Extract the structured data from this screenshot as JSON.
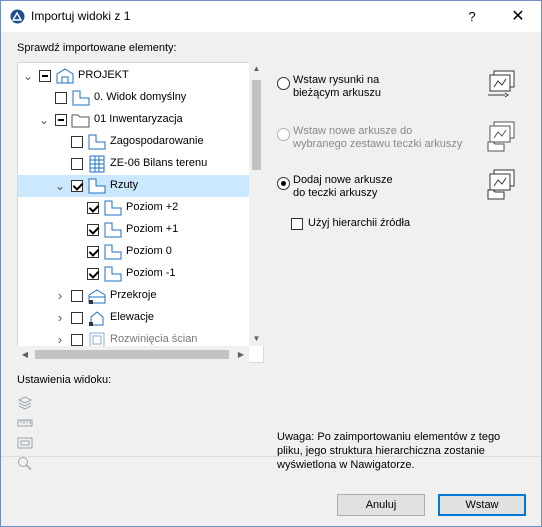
{
  "window": {
    "title": "Importuj widoki z 1"
  },
  "titlebar": {
    "help": "?",
    "close": "✕"
  },
  "labels": {
    "check_elements": "Sprawdź importowane elementy:",
    "view_settings": "Ustawienia widoku:"
  },
  "tree": {
    "items": [
      {
        "label": "PROJEKT",
        "depth": 0,
        "expander": "collapse",
        "check": "minus",
        "icon": "project-icon"
      },
      {
        "label": "0. Widok domyślny",
        "depth": 1,
        "expander": "none",
        "check": "unchecked",
        "icon": "view-icon"
      },
      {
        "label": "01 Inwentaryzacja",
        "depth": 1,
        "expander": "collapse",
        "check": "minus",
        "icon": "folder-icon"
      },
      {
        "label": "Zagospodarowanie",
        "depth": 2,
        "expander": "none",
        "check": "unchecked",
        "icon": "view-icon"
      },
      {
        "label": "ZE-06 Bilans terenu",
        "depth": 2,
        "expander": "none",
        "check": "unchecked",
        "icon": "table-icon"
      },
      {
        "label": "Rzuty",
        "depth": 2,
        "expander": "collapse",
        "check": "checked",
        "icon": "plan-icon",
        "selected": true
      },
      {
        "label": "Poziom +2",
        "depth": 3,
        "expander": "none",
        "check": "checked",
        "icon": "plan-icon"
      },
      {
        "label": "Poziom +1",
        "depth": 3,
        "expander": "none",
        "check": "checked",
        "icon": "plan-icon"
      },
      {
        "label": "Poziom 0",
        "depth": 3,
        "expander": "none",
        "check": "checked",
        "icon": "plan-icon"
      },
      {
        "label": "Poziom -1",
        "depth": 3,
        "expander": "none",
        "check": "checked",
        "icon": "plan-icon"
      },
      {
        "label": "Przekroje",
        "depth": 2,
        "expander": "expand",
        "check": "unchecked",
        "icon": "section-icon"
      },
      {
        "label": "Elewacje",
        "depth": 2,
        "expander": "expand",
        "check": "unchecked",
        "icon": "elevation-icon"
      },
      {
        "label": "Rozwinięcia ścian",
        "depth": 2,
        "expander": "expand",
        "check": "unchecked",
        "icon": "interior-elevation-icon",
        "dim": true
      }
    ]
  },
  "options": [
    {
      "label": "Wstaw rysunki na\nbieżącym arkuszu",
      "selected": false,
      "disabled": false,
      "icon": "place-drawings-icon"
    },
    {
      "label": "Wstaw nowe arkusze do\nwybranego zestawu teczki arkuszy",
      "selected": false,
      "disabled": true,
      "icon": "new-sheets-subset-icon"
    },
    {
      "label": "Dodaj nowe arkusze\ndo teczki arkuszy",
      "selected": true,
      "disabled": false,
      "icon": "add-sheets-icon"
    }
  ],
  "hierarchy": {
    "label": "Użyj hierarchii źródła",
    "checked": false
  },
  "note": "Uwaga: Po zaimportowaniu elementów z tego pliku, jego struktura hierarchiczna zostanie wyświetlona w Nawigatorze.",
  "buttons": {
    "cancel": "Anuluj",
    "ok": "Wstaw"
  },
  "colors": {
    "selection": "#cce8ff",
    "accent": "#0078d7",
    "icon_blue": "#1e6fc4"
  }
}
